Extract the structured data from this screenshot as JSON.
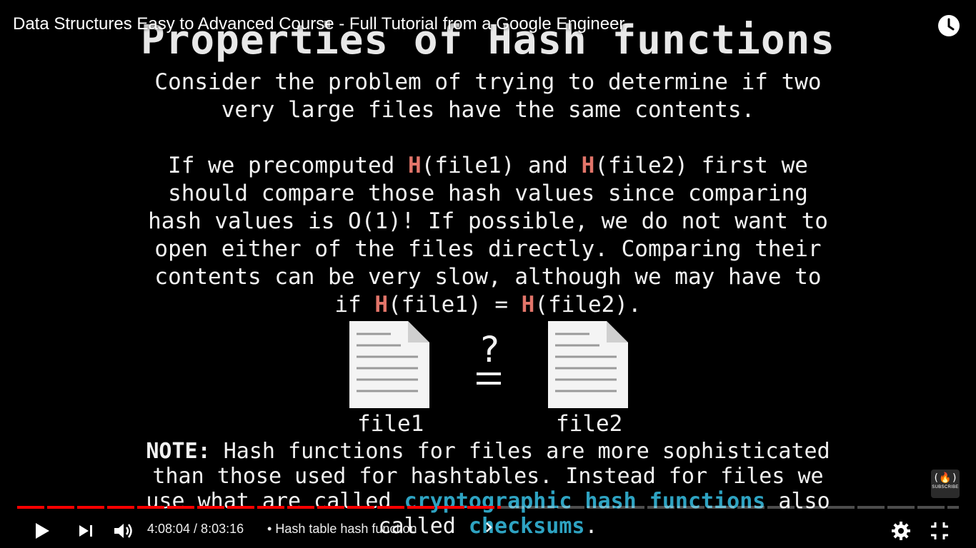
{
  "video": {
    "title": "Data Structures Easy to Advanced Course - Full Tutorial from a Google Engineer"
  },
  "slide": {
    "heading": "Properties of Hash functions",
    "para1": [
      "Consider the problem of trying to determine if two",
      "very large files have the same contents."
    ],
    "para2": {
      "line1_a": "If we precomputed ",
      "h": "H",
      "line1_b": "(file1) and ",
      "line1_c": "(file2) first we",
      "line2": "should compare those hash values since comparing",
      "line3": "hash values is O(1)! If possible, we do not want to",
      "line4": "open either of the files directly. Comparing their",
      "line5": "contents can be very slow, although we may have to",
      "line6_a": "if ",
      "line6_b": "(file1) = ",
      "line6_c": "(file2)."
    },
    "question_mark": "?",
    "file1_label": "file1",
    "file2_label": "file2",
    "note": {
      "label": "NOTE:",
      "line1": " Hash functions for files are more sophisticated",
      "line2": "than those used for hashtables. Instead for files we",
      "line3_a": "use what are called ",
      "line3_crypto": "cryptographic hash functions",
      "line3_b": " also",
      "line4_a": "called ",
      "line4_checksums": "checksums",
      "line4_b": "."
    },
    "colors": {
      "highlight_red": "#e2756a",
      "highlight_cyan": "#2ea3c2"
    }
  },
  "player": {
    "progress": 0.514,
    "time_display": "4:08:04 / 8:03:16",
    "chapter_separator": "•",
    "chapter_title": "Hash table hash function",
    "subscribe_label": "SUBSCRIBE",
    "subscribe_glyph": "(🔥)",
    "icons": [
      "play-icon",
      "next-icon",
      "volume-icon",
      "chevron-right-icon",
      "settings-icon",
      "exit-fullscreen-icon",
      "clock-icon"
    ],
    "accent": "#ff0000"
  }
}
